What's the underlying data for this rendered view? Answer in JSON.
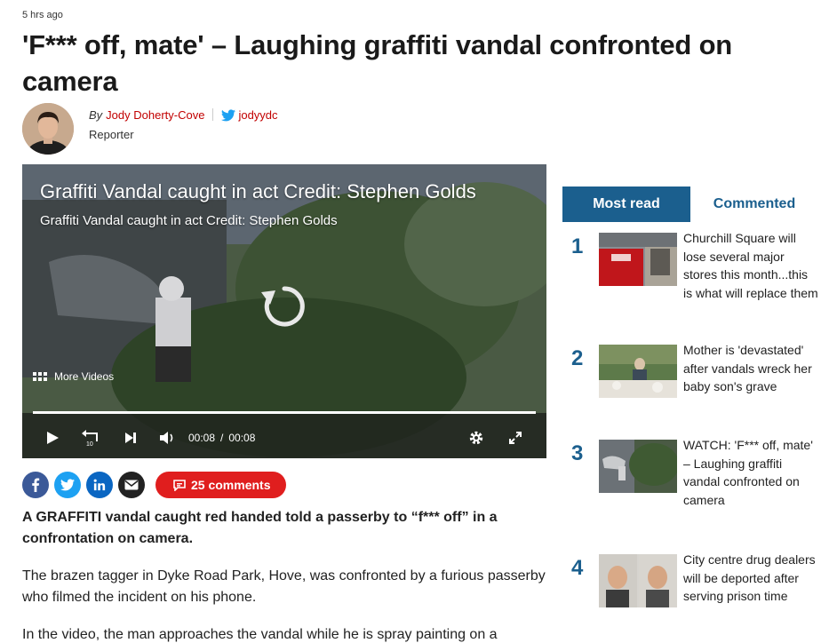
{
  "article": {
    "timestamp": "5 hrs ago",
    "headline": "'F*** off, mate' – Laughing graffiti vandal confronted on camera",
    "byline": {
      "by": "By",
      "author": "Jody Doherty-Cove",
      "twitter_handle": "jodyydc",
      "role": "Reporter"
    },
    "paragraphs": [
      "A GRAFFITI vandal caught red handed told a passerby to “f*** off” in a confrontation on camera.",
      "The brazen tagger in Dyke Road Park, Hove, was confronted by a furious passerby who filmed the incident on his phone.",
      "In the video, the man approaches the vandal while he is spray painting on a"
    ]
  },
  "video": {
    "title": "Graffiti Vandal caught in act Credit: Stephen Golds",
    "subtitle": "Graffiti Vandal caught in act Credit: Stephen Golds",
    "more_videos": "More Videos",
    "current_time": "00:08",
    "time_separator": "/",
    "duration": "00:08",
    "progress": 1.0,
    "icons": [
      "replay-icon",
      "play-icon",
      "rewind-10-icon",
      "next-icon",
      "volume-icon",
      "settings-icon",
      "fullscreen-icon"
    ]
  },
  "share": {
    "comments_label": "25 comments",
    "icons": [
      "facebook-icon",
      "twitter-icon",
      "linkedin-icon",
      "email-icon",
      "comment-icon"
    ]
  },
  "sidebar": {
    "tabs": [
      {
        "label": "Most read",
        "active": true
      },
      {
        "label": "Commented",
        "active": false
      }
    ],
    "most_read": [
      {
        "rank": "1",
        "title": "Churchill Square will lose several major stores this month...this is what will replace them"
      },
      {
        "rank": "2",
        "title": "Mother is 'devastated' after vandals wreck her baby son's grave"
      },
      {
        "rank": "3",
        "title": "WATCH: 'F*** off, mate' – Laughing graffiti vandal confronted on camera"
      },
      {
        "rank": "4",
        "title": "City centre drug dealers will be deported after serving prison time"
      }
    ]
  },
  "colors": {
    "accent_red": "#c20000",
    "comments_red": "#e01e1e",
    "sidebar_blue": "#1b5f8e",
    "facebook": "#3b5998",
    "twitter": "#1da1f2",
    "linkedin": "#0a66c2"
  }
}
